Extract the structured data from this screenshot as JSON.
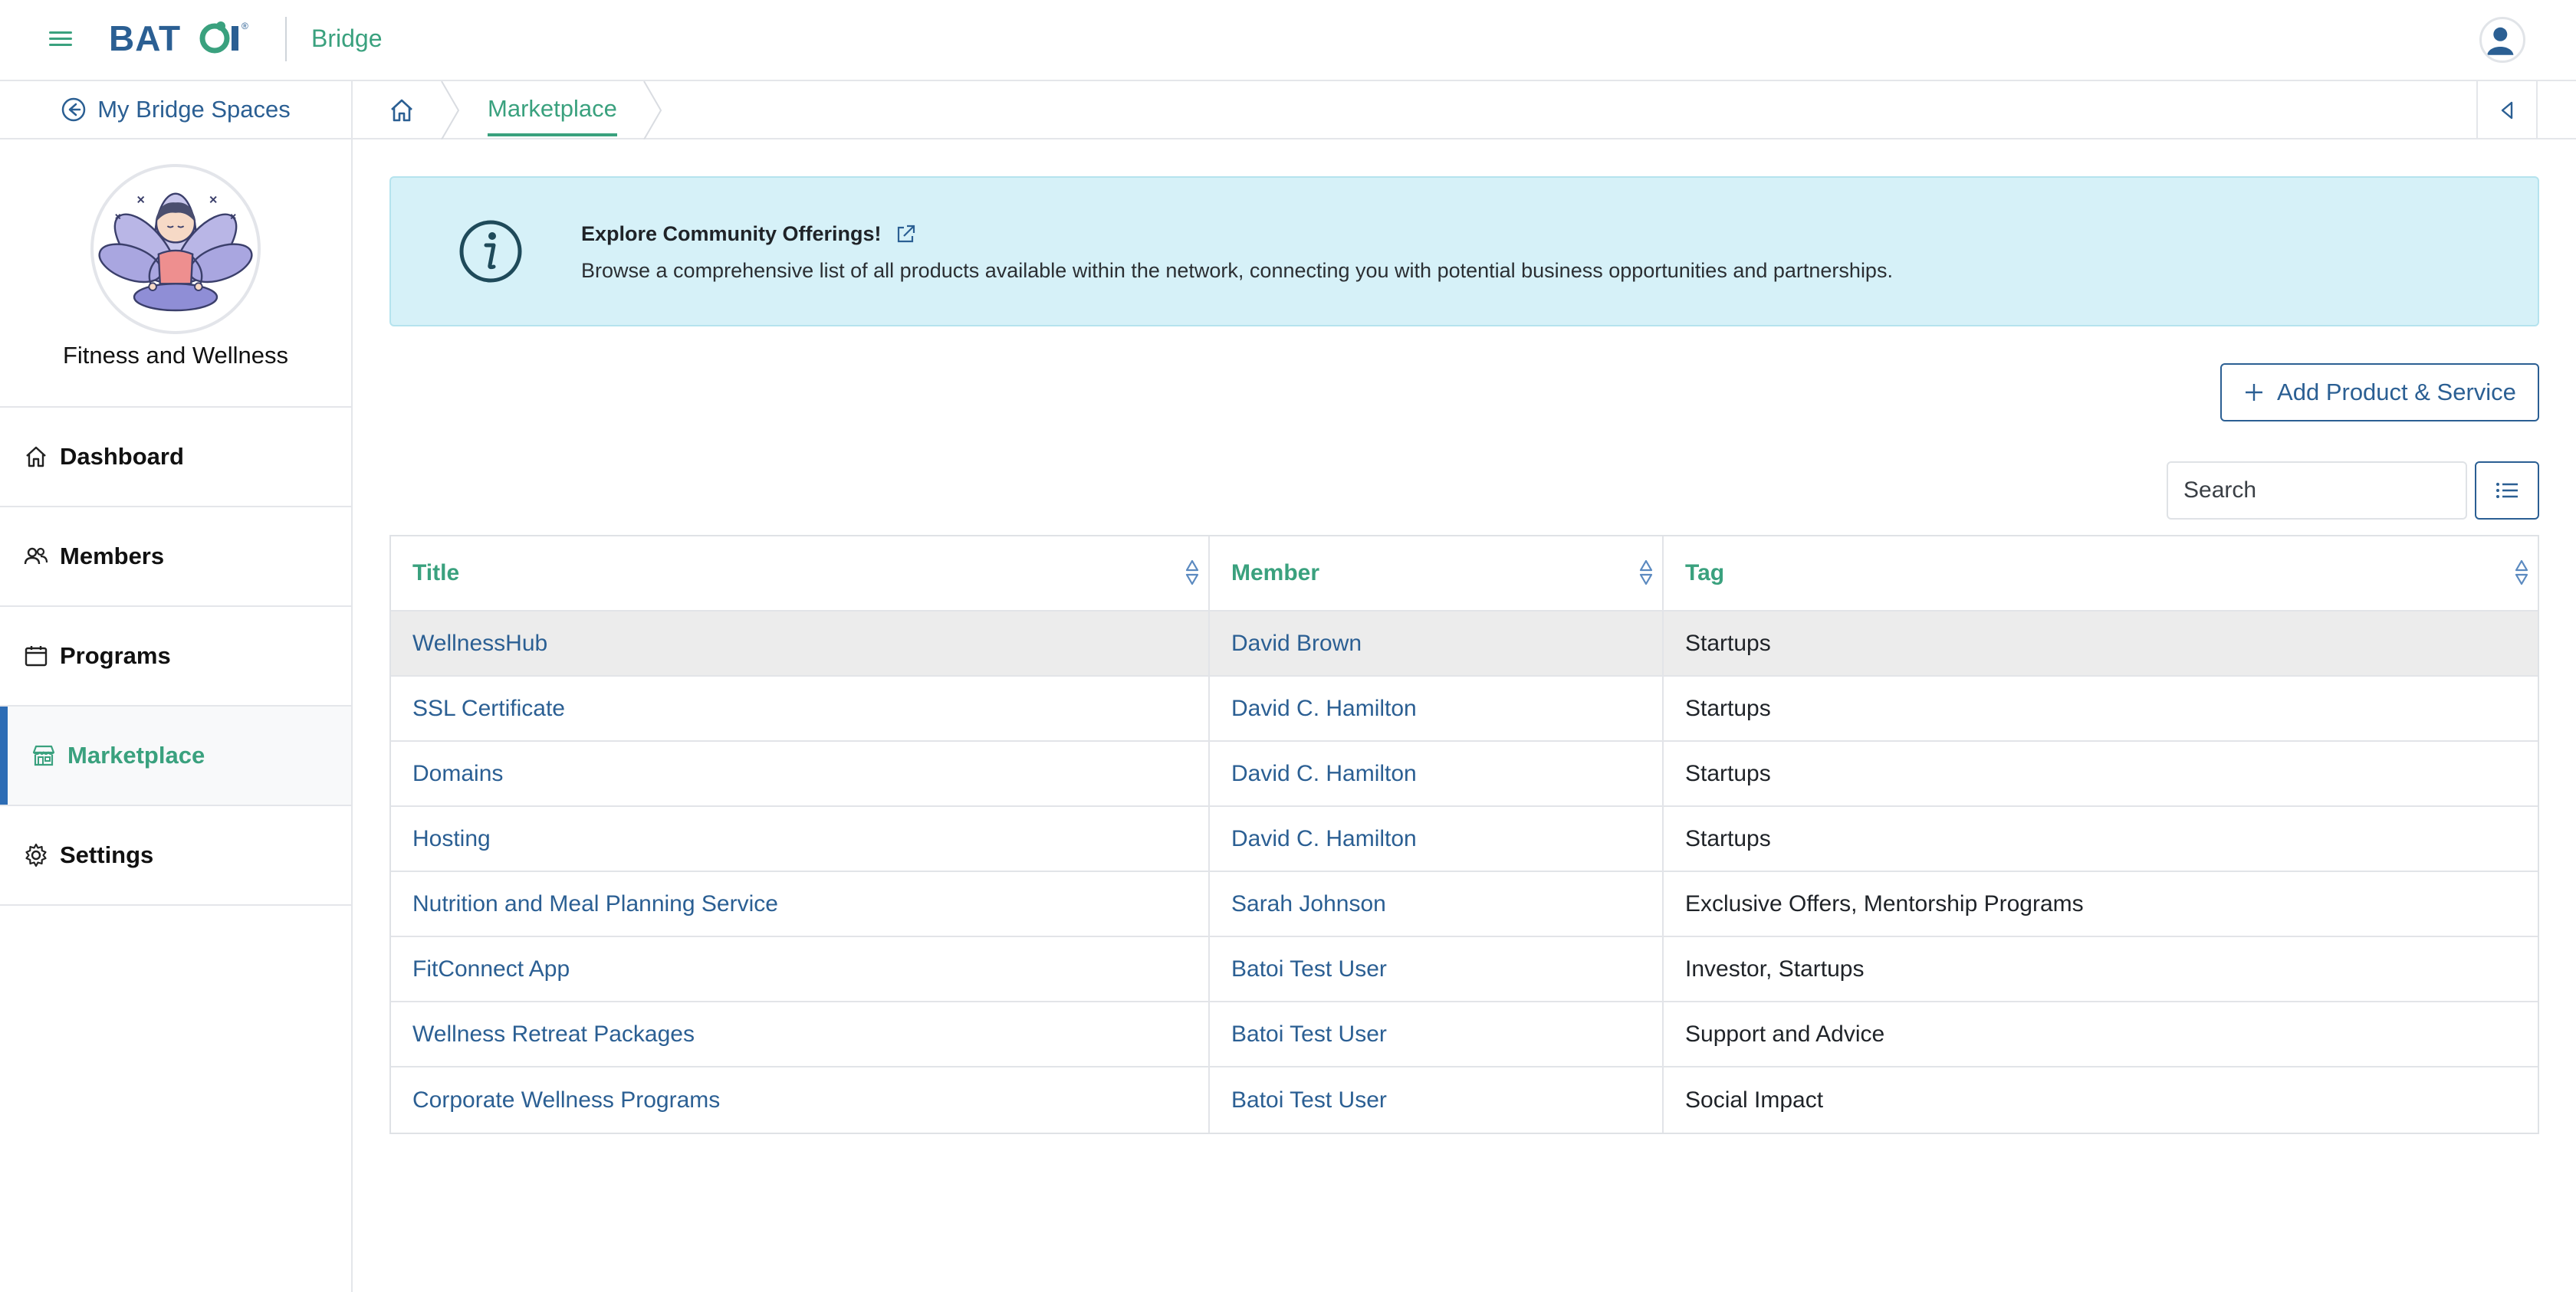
{
  "header": {
    "logo_text": "BATOI",
    "product": "Bridge",
    "menu_icon": "hamburger-menu-icon",
    "user_icon": "user-avatar-icon"
  },
  "sidebar": {
    "back_label": "My Bridge Spaces",
    "space_name": "Fitness and Wellness",
    "items": [
      {
        "label": "Dashboard",
        "icon": "home-icon",
        "active": false
      },
      {
        "label": "Members",
        "icon": "users-icon",
        "active": false
      },
      {
        "label": "Programs",
        "icon": "calendar-icon",
        "active": false
      },
      {
        "label": "Marketplace",
        "icon": "store-icon",
        "active": true
      },
      {
        "label": "Settings",
        "icon": "gear-icon",
        "active": false
      }
    ]
  },
  "breadcrumb": {
    "home_icon": "home-icon",
    "current": "Marketplace"
  },
  "banner": {
    "title": "Explore Community Offerings!",
    "description": "Browse a comprehensive list of all products available within the network, connecting you with potential business opportunities and partnerships."
  },
  "actions": {
    "add_label": "Add Product & Service",
    "search_placeholder": "Search"
  },
  "table": {
    "columns": [
      "Title",
      "Member",
      "Tag"
    ],
    "rows": [
      {
        "title": "WellnessHub",
        "member": "David Brown",
        "tag": "Startups"
      },
      {
        "title": "SSL Certificate",
        "member": "David C. Hamilton",
        "tag": "Startups"
      },
      {
        "title": "Domains",
        "member": "David C. Hamilton",
        "tag": "Startups"
      },
      {
        "title": "Hosting",
        "member": "David C. Hamilton",
        "tag": "Startups"
      },
      {
        "title": "Nutrition and Meal Planning Service",
        "member": "Sarah Johnson",
        "tag": "Exclusive Offers, Mentorship Programs"
      },
      {
        "title": "FitConnect App",
        "member": "Batoi Test User",
        "tag": "Investor, Startups"
      },
      {
        "title": "Wellness Retreat Packages",
        "member": "Batoi Test User",
        "tag": "Support and Advice"
      },
      {
        "title": "Corporate Wellness Programs",
        "member": "Batoi Test User",
        "tag": "Social Impact"
      }
    ]
  },
  "colors": {
    "brand_green": "#3aa17e",
    "brand_blue": "#2b5f93",
    "banner_bg": "#d6f1f8"
  }
}
